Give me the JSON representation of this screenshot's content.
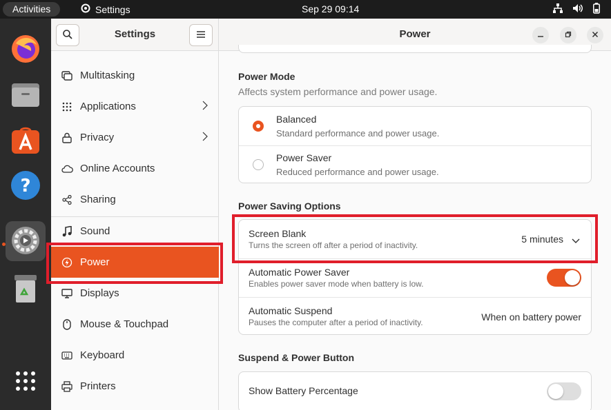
{
  "topbar": {
    "activities": "Activities",
    "app_name": "Settings",
    "clock": "Sep 29  09:14"
  },
  "dock": {
    "apps": [
      "firefox-icon",
      "files-icon",
      "app-center-icon",
      "help-icon",
      "settings-icon",
      "trash-icon",
      "show-apps-icon"
    ]
  },
  "sidebar": {
    "title": "Settings",
    "items": [
      {
        "label": "Multitasking",
        "icon": "multitasking-icon"
      },
      {
        "label": "Applications",
        "icon": "applications-icon"
      },
      {
        "label": "Privacy",
        "icon": "privacy-icon"
      },
      {
        "label": "Online Accounts",
        "icon": "cloud-icon"
      },
      {
        "label": "Sharing",
        "icon": "share-icon"
      },
      {
        "label": "Sound",
        "icon": "music-note-icon"
      },
      {
        "label": "Power",
        "icon": "power-icon"
      },
      {
        "label": "Displays",
        "icon": "display-icon"
      },
      {
        "label": "Mouse & Touchpad",
        "icon": "mouse-icon"
      },
      {
        "label": "Keyboard",
        "icon": "keyboard-icon"
      },
      {
        "label": "Printers",
        "icon": "printer-icon"
      }
    ]
  },
  "main": {
    "title": "Power",
    "power_mode": {
      "title": "Power Mode",
      "subtitle": "Affects system performance and power usage.",
      "options": [
        {
          "label": "Balanced",
          "desc": "Standard performance and power usage.",
          "selected": true
        },
        {
          "label": "Power Saver",
          "desc": "Reduced performance and power usage.",
          "selected": false
        }
      ]
    },
    "saving": {
      "title": "Power Saving Options",
      "screen_blank": {
        "label": "Screen Blank",
        "desc": "Turns the screen off after a period of inactivity.",
        "value": "5 minutes"
      },
      "auto_saver": {
        "label": "Automatic Power Saver",
        "desc": "Enables power saver mode when battery is low.",
        "enabled": true
      },
      "auto_suspend": {
        "label": "Automatic Suspend",
        "desc": "Pauses the computer after a period of inactivity.",
        "value": "When on battery power"
      }
    },
    "suspend": {
      "title": "Suspend & Power Button",
      "battery_pct": {
        "label": "Show Battery Percentage",
        "enabled": false
      }
    }
  },
  "colors": {
    "accent": "#e95420",
    "highlight": "#e01e2b",
    "dock": "#2b2b2b",
    "topbar": "#1c1c1c"
  }
}
